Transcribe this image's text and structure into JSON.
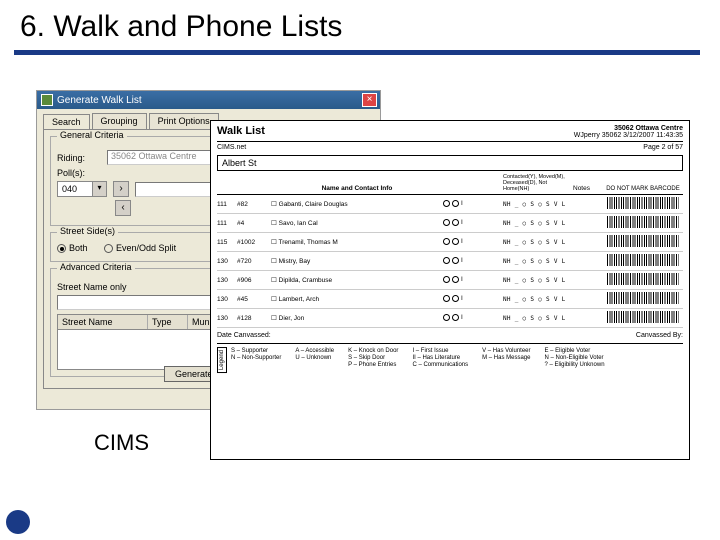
{
  "slide": {
    "title": "6. Walk and Phone Lists",
    "cims_label": "CIMS"
  },
  "dialog": {
    "title": "Generate Walk List",
    "tabs": [
      "Search",
      "Grouping",
      "Print Options"
    ],
    "group_general": "General Criteria",
    "label_riding": "Riding:",
    "riding_value": "35062 Ottawa Centre",
    "label_polls": "Poll(s):",
    "poll_value": "040",
    "group_sides": "Street Side(s)",
    "radio_both": "Both",
    "radio_even": "Even/Odd Split",
    "group_advanced": "Advanced Criteria",
    "street_label": "Street Name only",
    "col_street": "Street Name",
    "col_type": "Type",
    "col_muni": "Municipality",
    "btn_generate": "Generate Report"
  },
  "walklist": {
    "title": "Walk List",
    "riding": "35062 Ottawa Centre",
    "author_line": "WJperry 35062 3/12/2007 11:43:35",
    "source": "CIMS.net",
    "page": "Page 2 of 57",
    "street": "Albert St",
    "head_name": "Name and Contact Info",
    "head_contacted": "Contacted(Y), Moved(M), Deceased(D), Not Home(NH)",
    "head_notes": "Notes",
    "head_barcode": "DO NOT MARK BARCODE",
    "rows": [
      {
        "id": "111",
        "unit": "#82",
        "name": "Gabanti, Claire Douglas"
      },
      {
        "id": "111",
        "unit": "#4",
        "name": "Savo, Ian Cal"
      },
      {
        "id": "115",
        "unit": "#1002",
        "name": "Trenamil, Thomas M"
      },
      {
        "id": "130",
        "unit": "#720",
        "name": "Mistry, Bay"
      },
      {
        "id": "130",
        "unit": "#906",
        "name": "Dipilda, Crambuse"
      },
      {
        "id": "130",
        "unit": "#45",
        "name": "Lambert, Arch"
      },
      {
        "id": "130",
        "unit": "#128",
        "name": "Dier, Jon"
      }
    ],
    "canvassed_label": "Date Canvassed:",
    "canvassed_by": "Canvassed By:",
    "legend_title": "Legend",
    "legend": {
      "c1": [
        "S – Supporter",
        "N – Non-Supporter"
      ],
      "c2": [
        "A – Accessible",
        "U – Unknown"
      ],
      "c3": [
        "K – Knock on Door",
        "S – Skip Door",
        "P – Phone Entries"
      ],
      "c4": [
        "I – First Issue",
        "II – Has Literature",
        "C – Communications"
      ],
      "c5": [
        "V – Has Volunteer",
        "M – Has Message"
      ],
      "c6": [
        "E – Eligible Voter",
        "N – Non-Eligible Voter",
        "? – Eligibility Unknown"
      ]
    }
  }
}
